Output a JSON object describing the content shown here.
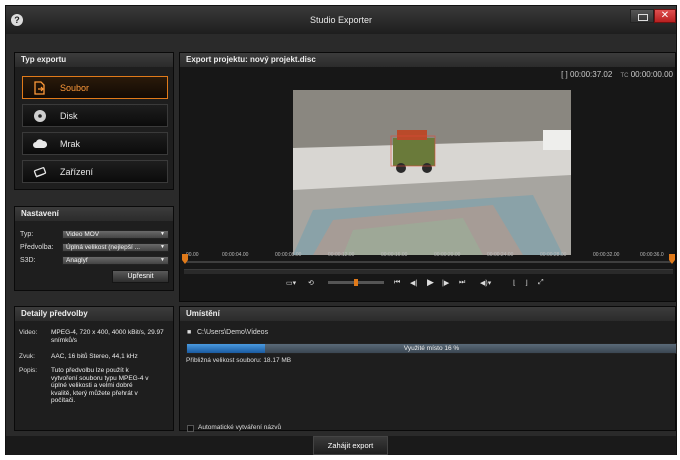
{
  "window": {
    "title": "Studio Exporter",
    "help_symbol": "?",
    "close_symbol": "✕"
  },
  "export_type": {
    "header": "Typ exportu",
    "buttons": [
      {
        "label": "Soubor",
        "icon": "file-export-icon",
        "selected": true
      },
      {
        "label": "Disk",
        "icon": "disc-icon",
        "selected": false
      },
      {
        "label": "Mrak",
        "icon": "cloud-icon",
        "selected": false
      },
      {
        "label": "Zařízení",
        "icon": "device-icon",
        "selected": false
      }
    ],
    "accent_color": "#e07a1a"
  },
  "settings": {
    "header": "Nastavení",
    "type_label": "Typ:",
    "type_value": "Video MOV",
    "preset_label": "Předvolba:",
    "preset_value": "Úplná velikost (nejlepší ...",
    "s3d_label": "S3D:",
    "s3d_value": "Anaglyf",
    "refine_label": "Upřesnit"
  },
  "preset_details": {
    "header": "Detaily předvolby",
    "video_label": "Video:",
    "video_value": "MPEG-4, 720 x 400, 4000 kBit/s, 29.97 snímků/s",
    "audio_label": "Zvuk:",
    "audio_value": "AAC, 16 bitů Stereo, 44,1 kHz",
    "desc_label": "Popis:",
    "desc_value": "Tuto předvolbu lze použít k vytvoření souboru typu MPEG-4 v úplné velikosti a velmi dobré kvalitě, který můžete přehrát v počítači."
  },
  "preview": {
    "header": "Export projektu: nový projekt.disc",
    "duration_symbol": "[ ]",
    "duration": "00:00:37.02",
    "tc_label": "TC",
    "timecode": "00:00:00.00",
    "timeline_labels": [
      "00.00",
      "00:00:04.00",
      "00:00:08.00",
      "00:00:12.00",
      "00:00:16.00",
      "00:00:20.00",
      "00:00:24.00",
      "00:00:28.00",
      "00:00:32.00",
      "00:00:36.0"
    ]
  },
  "location": {
    "header": "Umístění",
    "path": "C:\\Users\\Demo\\Videos",
    "space_used_text": "Využité místo 16 %",
    "space_used_percent": 16,
    "file_size_text": "Přibližná velikost souboru: 18.17 MB",
    "auto_naming_label": "Automatické vytváření názvů",
    "auto_naming_checked": false
  },
  "footer": {
    "start_label": "Zahájit export"
  }
}
